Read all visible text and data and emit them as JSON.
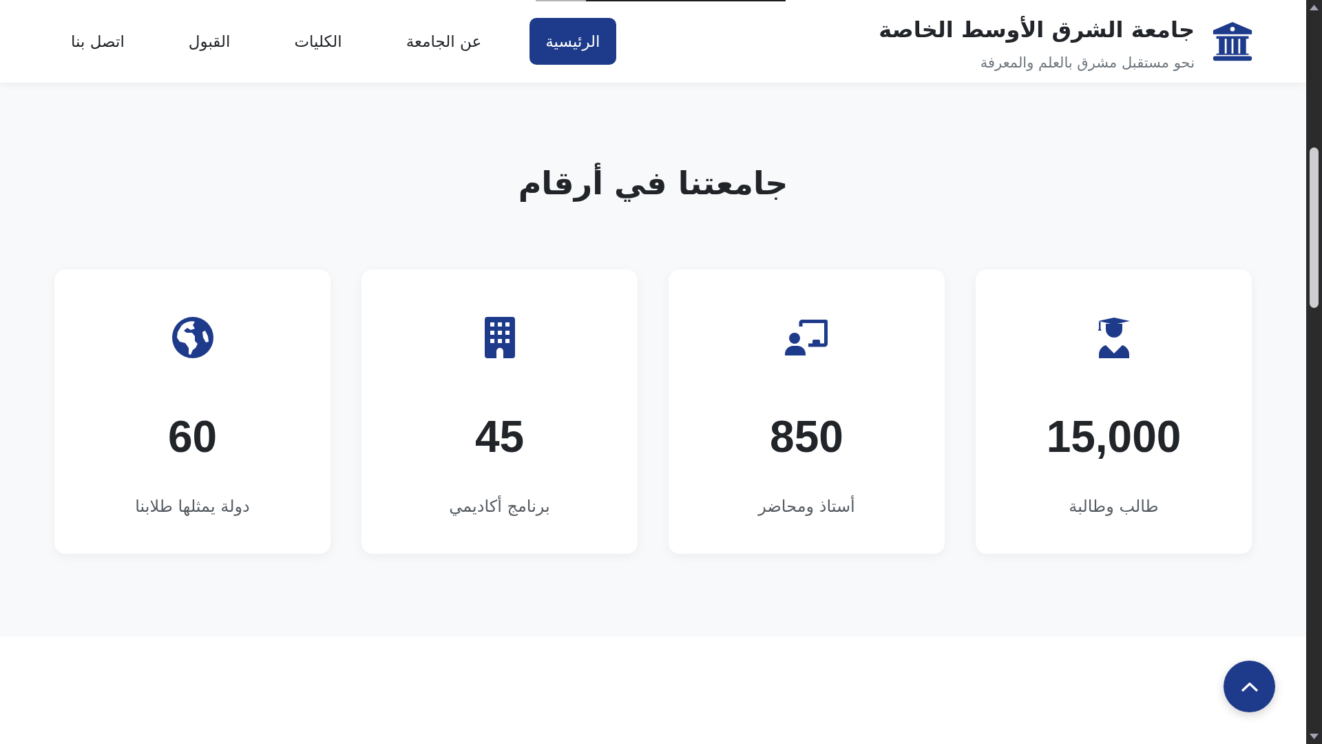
{
  "header": {
    "title": "جامعة الشرق الأوسط الخاصة",
    "tagline": "نحو مستقبل مشرق بالعلم والمعرفة"
  },
  "nav": [
    {
      "label": "الرئيسية",
      "selected": true
    },
    {
      "label": "عن الجامعة",
      "selected": false
    },
    {
      "label": "الكليات",
      "selected": false
    },
    {
      "label": "القبول",
      "selected": false
    },
    {
      "label": "اتصل بنا",
      "selected": false
    }
  ],
  "stats": {
    "heading": "جامعتنا في أرقام",
    "cards": [
      {
        "kind": "students",
        "value": "15,000",
        "label": "طالب وطالبة"
      },
      {
        "kind": "faculty",
        "value": "850",
        "label": "أستاذ ومحاضر"
      },
      {
        "kind": "programs",
        "value": "45",
        "label": "برنامج أكاديمي"
      },
      {
        "kind": "countries",
        "value": "60",
        "label": "دولة يمثلها طلابنا"
      }
    ]
  }
}
